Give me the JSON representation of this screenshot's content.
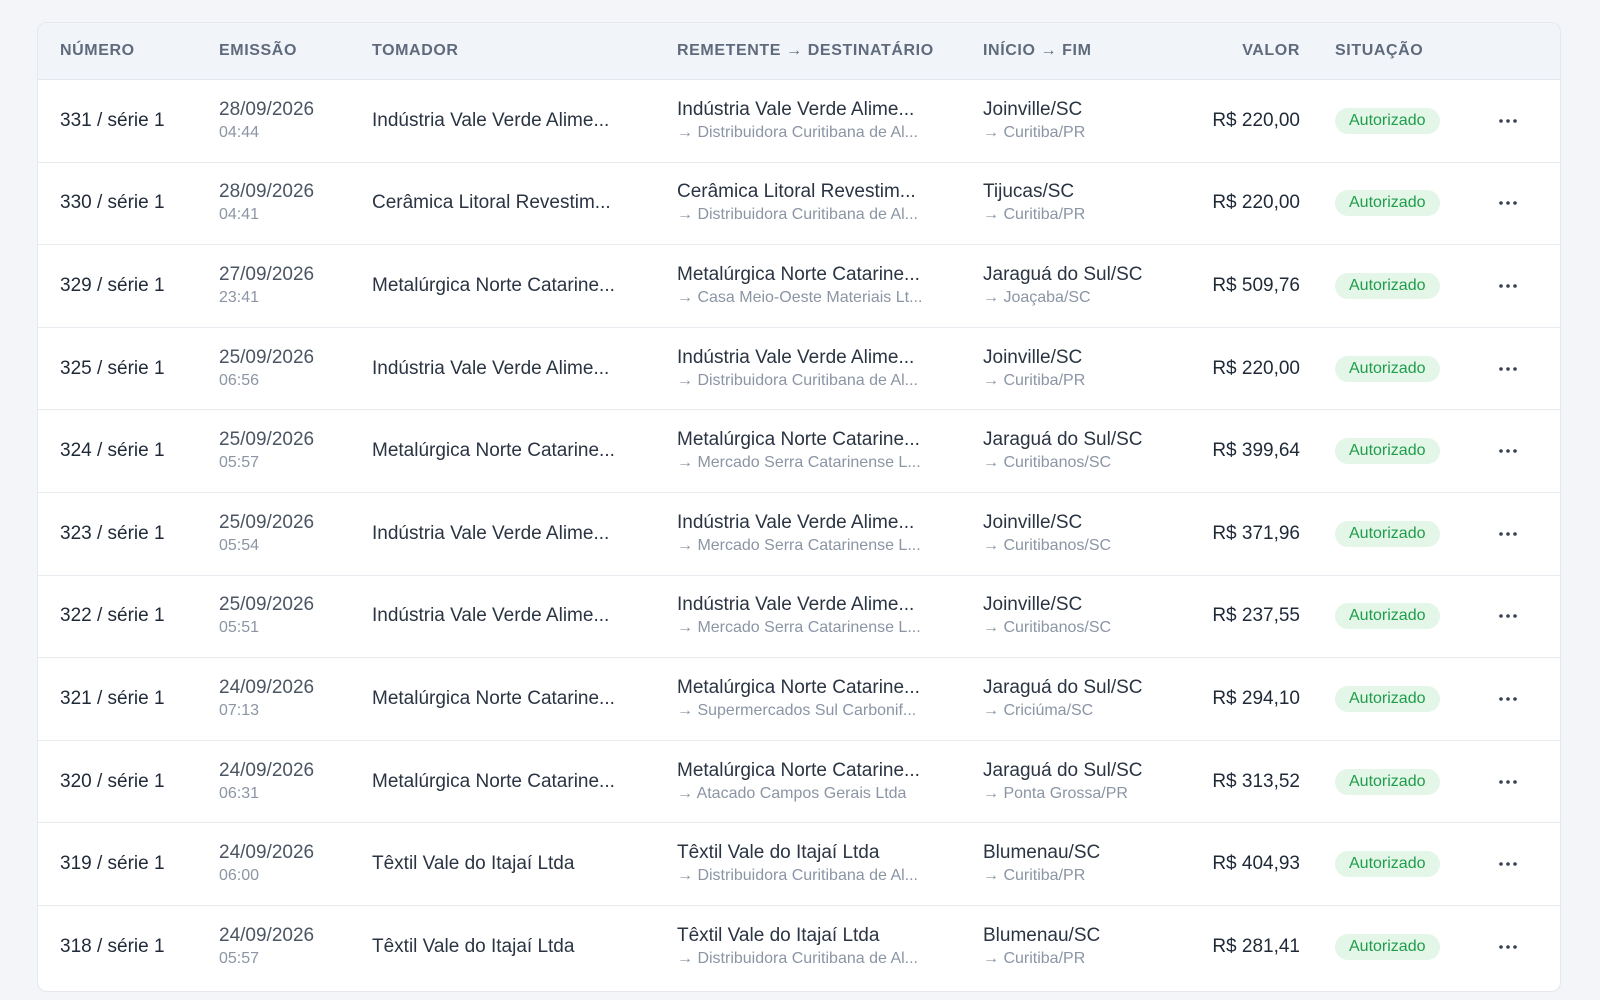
{
  "table": {
    "headers": {
      "numero": "NÚMERO",
      "emissao": "EMISSÃO",
      "tomador": "TOMADOR",
      "remetente_destinatario": "REMETENTE → DESTINATÁRIO",
      "inicio_fim": "INÍCIO → FIM",
      "valor": "VALOR",
      "situacao": "SITUAÇÃO"
    },
    "status_color": "#1f9d4a",
    "status_bg": "#e3f6e8",
    "actions_icon": "more-horizontal-icon",
    "rows": [
      {
        "numero": "331 / série 1",
        "data": "28/09/2026",
        "hora": "04:44",
        "tomador": "Indústria Vale Verde Alime...",
        "remetente": "Indústria Vale Verde Alime...",
        "destinatario": "→ Distribuidora Curitibana de Al...",
        "inicio": "Joinville/SC",
        "fim": "→ Curitiba/PR",
        "valor": "R$ 220,00",
        "situacao": "Autorizado"
      },
      {
        "numero": "330 / série 1",
        "data": "28/09/2026",
        "hora": "04:41",
        "tomador": "Cerâmica Litoral Revestim...",
        "remetente": "Cerâmica Litoral Revestim...",
        "destinatario": "→ Distribuidora Curitibana de Al...",
        "inicio": "Tijucas/SC",
        "fim": "→ Curitiba/PR",
        "valor": "R$ 220,00",
        "situacao": "Autorizado"
      },
      {
        "numero": "329 / série 1",
        "data": "27/09/2026",
        "hora": "23:41",
        "tomador": "Metalúrgica Norte Catarine...",
        "remetente": "Metalúrgica Norte Catarine...",
        "destinatario": "→ Casa Meio-Oeste Materiais Lt...",
        "inicio": "Jaraguá do Sul/SC",
        "fim": "→ Joaçaba/SC",
        "valor": "R$ 509,76",
        "situacao": "Autorizado"
      },
      {
        "numero": "325 / série 1",
        "data": "25/09/2026",
        "hora": "06:56",
        "tomador": "Indústria Vale Verde Alime...",
        "remetente": "Indústria Vale Verde Alime...",
        "destinatario": "→ Distribuidora Curitibana de Al...",
        "inicio": "Joinville/SC",
        "fim": "→ Curitiba/PR",
        "valor": "R$ 220,00",
        "situacao": "Autorizado"
      },
      {
        "numero": "324 / série 1",
        "data": "25/09/2026",
        "hora": "05:57",
        "tomador": "Metalúrgica Norte Catarine...",
        "remetente": "Metalúrgica Norte Catarine...",
        "destinatario": "→ Mercado Serra Catarinense L...",
        "inicio": "Jaraguá do Sul/SC",
        "fim": "→ Curitibanos/SC",
        "valor": "R$ 399,64",
        "situacao": "Autorizado"
      },
      {
        "numero": "323 / série 1",
        "data": "25/09/2026",
        "hora": "05:54",
        "tomador": "Indústria Vale Verde Alime...",
        "remetente": "Indústria Vale Verde Alime...",
        "destinatario": "→ Mercado Serra Catarinense L...",
        "inicio": "Joinville/SC",
        "fim": "→ Curitibanos/SC",
        "valor": "R$ 371,96",
        "situacao": "Autorizado"
      },
      {
        "numero": "322 / série 1",
        "data": "25/09/2026",
        "hora": "05:51",
        "tomador": "Indústria Vale Verde Alime...",
        "remetente": "Indústria Vale Verde Alime...",
        "destinatario": "→ Mercado Serra Catarinense L...",
        "inicio": "Joinville/SC",
        "fim": "→ Curitibanos/SC",
        "valor": "R$ 237,55",
        "situacao": "Autorizado"
      },
      {
        "numero": "321 / série 1",
        "data": "24/09/2026",
        "hora": "07:13",
        "tomador": "Metalúrgica Norte Catarine...",
        "remetente": "Metalúrgica Norte Catarine...",
        "destinatario": "→ Supermercados Sul Carbonif...",
        "inicio": "Jaraguá do Sul/SC",
        "fim": "→ Criciúma/SC",
        "valor": "R$ 294,10",
        "situacao": "Autorizado"
      },
      {
        "numero": "320 / série 1",
        "data": "24/09/2026",
        "hora": "06:31",
        "tomador": "Metalúrgica Norte Catarine...",
        "remetente": "Metalúrgica Norte Catarine...",
        "destinatario": "→ Atacado Campos Gerais Ltda",
        "inicio": "Jaraguá do Sul/SC",
        "fim": "→ Ponta Grossa/PR",
        "valor": "R$ 313,52",
        "situacao": "Autorizado"
      },
      {
        "numero": "319 / série 1",
        "data": "24/09/2026",
        "hora": "06:00",
        "tomador": "Têxtil Vale do Itajaí Ltda",
        "remetente": "Têxtil Vale do Itajaí Ltda",
        "destinatario": "→ Distribuidora Curitibana de Al...",
        "inicio": "Blumenau/SC",
        "fim": "→ Curitiba/PR",
        "valor": "R$ 404,93",
        "situacao": "Autorizado"
      },
      {
        "numero": "318 / série 1",
        "data": "24/09/2026",
        "hora": "05:57",
        "tomador": "Têxtil Vale do Itajaí Ltda",
        "remetente": "Têxtil Vale do Itajaí Ltda",
        "destinatario": "→ Distribuidora Curitibana de Al...",
        "inicio": "Blumenau/SC",
        "fim": "→ Curitiba/PR",
        "valor": "R$ 281,41",
        "situacao": "Autorizado"
      }
    ]
  }
}
